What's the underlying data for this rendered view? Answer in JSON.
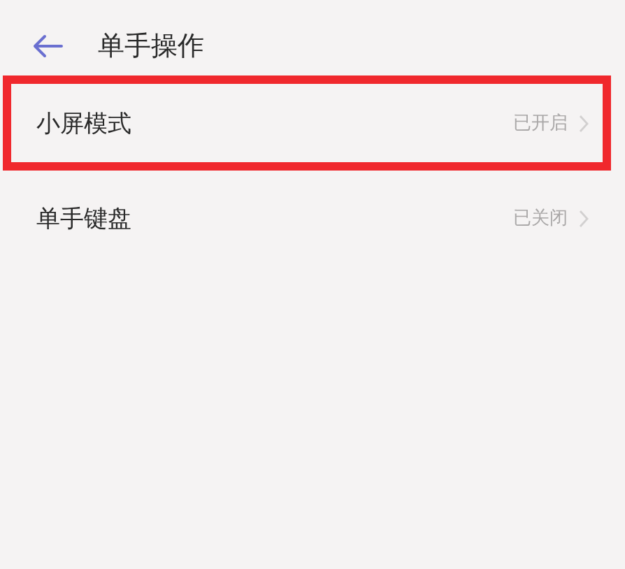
{
  "header": {
    "title": "单手操作"
  },
  "items": [
    {
      "label": "小屏模式",
      "value": "已开启",
      "highlighted": true
    },
    {
      "label": "单手键盘",
      "value": "已关闭",
      "highlighted": false
    }
  ]
}
